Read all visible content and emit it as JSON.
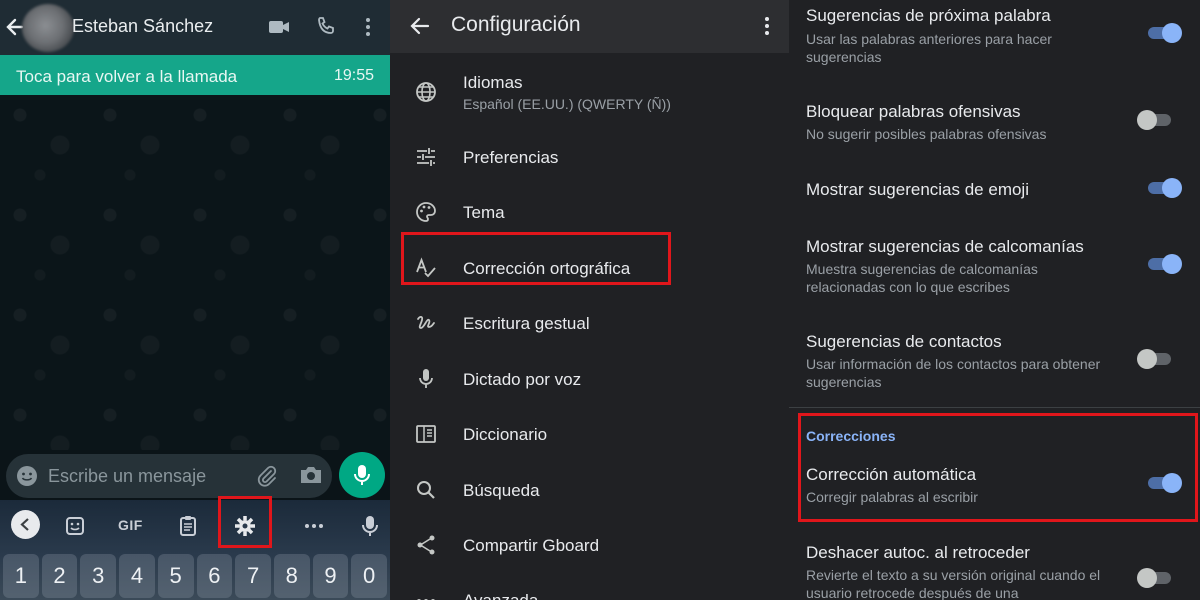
{
  "chat": {
    "contact_name": "Esteban Sánchez",
    "call_banner": "Toca para volver a la llamada",
    "call_time": "19:55",
    "input_placeholder": "Escribe un mensaje"
  },
  "keyboard": {
    "gif_label": "GIF",
    "number_keys": [
      "1",
      "2",
      "3",
      "4",
      "5",
      "6",
      "7",
      "8",
      "9",
      "0"
    ]
  },
  "settings": {
    "title": "Configuración",
    "items": [
      {
        "label": "Idiomas",
        "sub": "Español (EE.UU.) (QWERTY (Ñ))",
        "icon": "globe-icon"
      },
      {
        "label": "Preferencias",
        "icon": "sliders-icon"
      },
      {
        "label": "Tema",
        "icon": "palette-icon"
      },
      {
        "label": "Corrección ortográfica",
        "icon": "spellcheck-icon"
      },
      {
        "label": "Escritura gestual",
        "icon": "gesture-icon"
      },
      {
        "label": "Dictado por voz",
        "icon": "mic-icon"
      },
      {
        "label": "Diccionario",
        "icon": "book-icon"
      },
      {
        "label": "Búsqueda",
        "icon": "search-icon"
      },
      {
        "label": "Compartir Gboard",
        "icon": "share-icon"
      },
      {
        "label": "Avanzada",
        "icon": "more-icon"
      }
    ]
  },
  "correction": {
    "options": [
      {
        "title": "Sugerencias de próxima palabra",
        "sub": "Usar las palabras anteriores para hacer sugerencias",
        "on": true
      },
      {
        "title": "Bloquear palabras ofensivas",
        "sub": "No sugerir posibles palabras ofensivas",
        "on": false
      },
      {
        "title": "Mostrar sugerencias de emoji",
        "sub": "",
        "on": true
      },
      {
        "title": "Mostrar sugerencias de calcomanías",
        "sub": "Muestra sugerencias de calcomanías relacionadas con lo que escribes",
        "on": true
      },
      {
        "title": "Sugerencias de contactos",
        "sub": "Usar información de los contactos para obtener sugerencias",
        "on": false
      }
    ],
    "section_label": "Correcciones",
    "section_options": [
      {
        "title": "Corrección automática",
        "sub": "Corregir palabras al escribir",
        "on": true
      },
      {
        "title": "Deshacer autoc. al retroceder",
        "sub": "Revierte el texto a su versión original cuando el usuario retrocede después de una",
        "on": false
      }
    ]
  },
  "colors": {
    "highlight": "#e0161b",
    "accent_teal": "#15a68a",
    "accent_blue": "#8ab4f8"
  }
}
